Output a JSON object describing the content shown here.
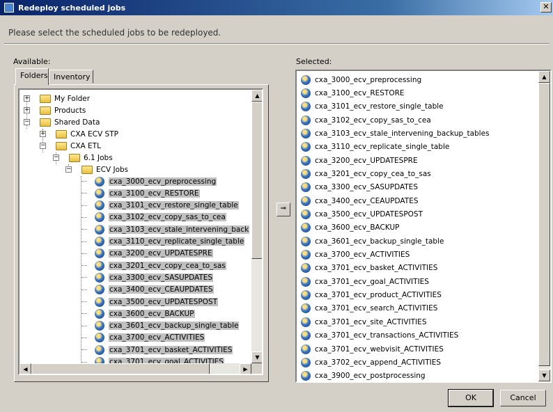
{
  "window": {
    "title": "Redeploy scheduled jobs",
    "close_glyph": "✕"
  },
  "instruction": "Please select the scheduled jobs to be redeployed.",
  "available_label": "Available:",
  "selected_label": "Selected:",
  "tabs": [
    {
      "label": "Folders"
    },
    {
      "label": "Inventory"
    }
  ],
  "tree": {
    "folders": [
      {
        "label": "My Folder"
      },
      {
        "label": "Products"
      },
      {
        "label": "Shared Data"
      },
      {
        "label": "CXA ECV STP"
      },
      {
        "label": "CXA ETL"
      },
      {
        "label": "6.1 Jobs"
      },
      {
        "label": "ECV Jobs"
      }
    ],
    "jobs": [
      {
        "label": "cxa_3000_ecv_preprocessing"
      },
      {
        "label": "cxa_3100_ecv_RESTORE"
      },
      {
        "label": "cxa_3101_ecv_restore_single_table"
      },
      {
        "label": "cxa_3102_ecv_copy_sas_to_cea"
      },
      {
        "label": "cxa_3103_ecv_stale_intervening_back"
      },
      {
        "label": "cxa_3110_ecv_replicate_single_table"
      },
      {
        "label": "cxa_3200_ecv_UPDATESPRE"
      },
      {
        "label": "cxa_3201_ecv_copy_cea_to_sas"
      },
      {
        "label": "cxa_3300_ecv_SASUPDATES"
      },
      {
        "label": "cxa_3400_ecv_CEAUPDATES"
      },
      {
        "label": "cxa_3500_ecv_UPDATESPOST"
      },
      {
        "label": "cxa_3600_ecv_BACKUP"
      },
      {
        "label": "cxa_3601_ecv_backup_single_table"
      },
      {
        "label": "cxa_3700_ecv_ACTIVITIES"
      },
      {
        "label": "cxa_3701_ecv_basket_ACTIVITIES"
      },
      {
        "label": "cxa_3701_ecv_goal_ACTIVITIES"
      }
    ]
  },
  "move_button": {
    "glyph": "⇒"
  },
  "selected": [
    {
      "label": "cxa_3000_ecv_preprocessing"
    },
    {
      "label": "cxa_3100_ecv_RESTORE"
    },
    {
      "label": "cxa_3101_ecv_restore_single_table"
    },
    {
      "label": "cxa_3102_ecv_copy_sas_to_cea"
    },
    {
      "label": "cxa_3103_ecv_stale_intervening_backup_tables"
    },
    {
      "label": "cxa_3110_ecv_replicate_single_table"
    },
    {
      "label": "cxa_3200_ecv_UPDATESPRE"
    },
    {
      "label": "cxa_3201_ecv_copy_cea_to_sas"
    },
    {
      "label": "cxa_3300_ecv_SASUPDATES"
    },
    {
      "label": "cxa_3400_ecv_CEAUPDATES"
    },
    {
      "label": "cxa_3500_ecv_UPDATESPOST"
    },
    {
      "label": "cxa_3600_ecv_BACKUP"
    },
    {
      "label": "cxa_3601_ecv_backup_single_table"
    },
    {
      "label": "cxa_3700_ecv_ACTIVITIES"
    },
    {
      "label": "cxa_3701_ecv_basket_ACTIVITIES"
    },
    {
      "label": "cxa_3701_ecv_goal_ACTIVITIES"
    },
    {
      "label": "cxa_3701_ecv_product_ACTIVITIES"
    },
    {
      "label": "cxa_3701_ecv_search_ACTIVITIES"
    },
    {
      "label": "cxa_3701_ecv_site_ACTIVITIES"
    },
    {
      "label": "cxa_3701_ecv_transactions_ACTIVITIES"
    },
    {
      "label": "cxa_3701_ecv_webvisit_ACTIVITIES"
    },
    {
      "label": "cxa_3702_ecv_append_ACTIVITIES"
    },
    {
      "label": "cxa_3900_ecv_postprocessing"
    }
  ],
  "buttons": {
    "ok": "OK",
    "cancel": "Cancel"
  },
  "scroll_glyphs": {
    "up": "▲",
    "down": "▼",
    "left": "◀",
    "right": "▶"
  },
  "tree_expanders": {
    "expanded": "−",
    "collapsed": "+"
  }
}
